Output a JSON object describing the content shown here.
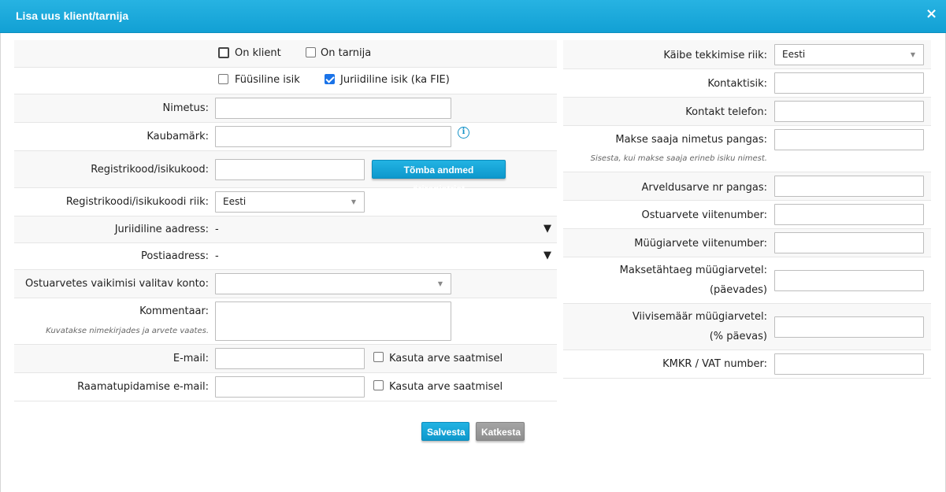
{
  "dialog": {
    "title": "Lisa uus klient/tarnija",
    "close_icon": "×"
  },
  "left": {
    "on_klient": "On klient",
    "on_tarnija": "On tarnija",
    "fuusiline": "Füüsiline isik",
    "juriidiline": "Juriidiline isik (ka FIE)",
    "nimetus_label": "Nimetus:",
    "kaubamark_label": "Kaubamärk:",
    "info_icon": "i",
    "regkood_label": "Registrikood/isikukood:",
    "fetch_button": "Tõmba andmed äriregistrist",
    "regkood_riik_label": "Registrikoodi/isikukoodi riik:",
    "regkood_riik_value": "Eesti",
    "jur_aadress_label": "Juriidiline aadress:",
    "jur_aadress_value": "-",
    "postiaadress_label": "Postiaadress:",
    "postiaadress_value": "-",
    "expand_icon": "▼",
    "konto_label": "Ostuarvetes vaikimisi valitav konto:",
    "kommentaar_label": "Kommentaar:",
    "kommentaar_hint": "Kuvatakse nimekirjades ja arvete vaates.",
    "email_label": "E-mail:",
    "kasuta_arve": "Kasuta arve saatmisel",
    "raamat_email_label": "Raamatupidamise e-mail:",
    "kasuta_arve2": "Kasuta arve saatmisel"
  },
  "right": {
    "kaibe_riik_label": "Käibe tekkimise riik:",
    "kaibe_riik_value": "Eesti",
    "kontaktisik_label": "Kontaktisik:",
    "kontakt_tel_label": "Kontakt telefon:",
    "makse_saaja_label": "Makse saaja nimetus pangas:",
    "makse_saaja_hint": "Sisesta, kui makse saaja erineb isiku nimest.",
    "arveldusarve_label": "Arveldusarve nr pangas:",
    "ostuarve_viite_label": "Ostuarvete viitenumber:",
    "muugiarve_viite_label": "Müügiarvete viitenumber:",
    "maksetahtaeg_label1": "Maksetähtaeg müügiarvetel:",
    "maksetahtaeg_label2": "(päevades)",
    "viivis_label1": "Viivisemäär müügiarvetel:",
    "viivis_label2": "(% päevas)",
    "kmkr_label": "KMKR / VAT number:"
  },
  "actions": {
    "save": "Salvesta",
    "cancel": "Katkesta"
  },
  "colors": {
    "accent": "#1aa8db",
    "cancel": "#999999"
  }
}
